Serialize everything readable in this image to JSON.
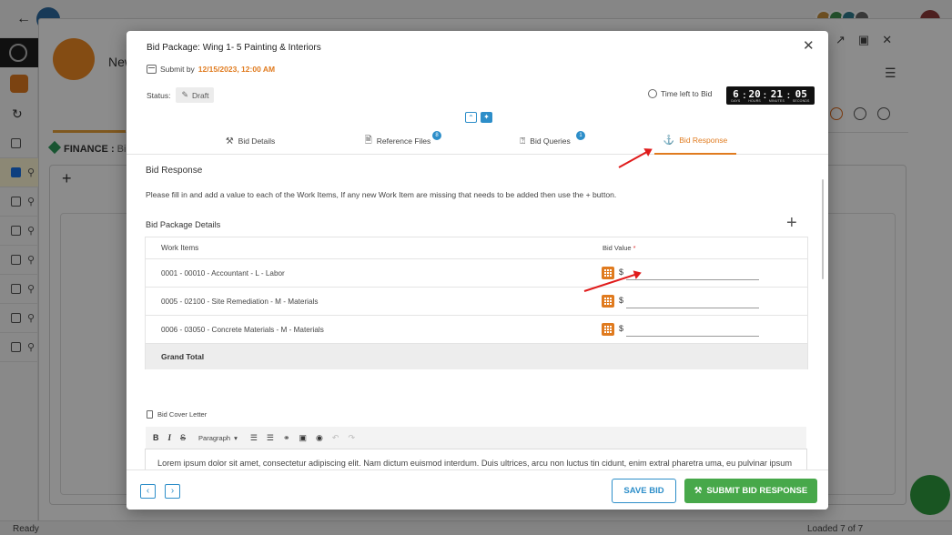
{
  "background": {
    "subwindow_title": "New",
    "finance_label": "FINANCE :",
    "finance_sub": "Bid",
    "status_left": "Ready",
    "status_right": "Loaded 7 of 7"
  },
  "modal": {
    "title": "Bid Package: Wing 1- 5 Painting & Interiors",
    "submit_by_label": "Submit by",
    "submit_by_date": "12/15/2023, 12:00 AM",
    "status_label": "Status:",
    "status_value": "Draft",
    "time_left_label": "Time left to Bid",
    "timer": {
      "days": "6",
      "hours": "20",
      "minutes": "21",
      "seconds": "05",
      "days_unit": "DAYS",
      "hours_unit": "HOURS",
      "minutes_unit": "MINUTES",
      "seconds_unit": "SECONDS"
    },
    "tabs": [
      {
        "label": "Bid Details",
        "icon": "gavel-icon",
        "badge": ""
      },
      {
        "label": "Reference Files",
        "icon": "files-icon",
        "badge": "8"
      },
      {
        "label": "Bid Queries",
        "icon": "question-icon",
        "badge": "1"
      },
      {
        "label": "Bid Response",
        "icon": "bid-response-icon",
        "badge": ""
      }
    ],
    "active_tab": "Bid Response",
    "section_title": "Bid Response",
    "instructions": "Please fill in and add a value to each of the Work Items, If any new Work Item are missing that needs to be added then use the + button.",
    "package_details_title": "Bid Package Details",
    "table": {
      "col_work_items": "Work Items",
      "col_bid_value": "Bid Value",
      "required_mark": "*",
      "currency": "$",
      "rows": [
        {
          "item": "0001 - 00010 - Accountant - L - Labor",
          "value": ""
        },
        {
          "item": "0005 - 02100 - Site Remediation - M - Materials",
          "value": ""
        },
        {
          "item": "0006 - 03050 - Concrete Materials - M - Materials",
          "value": ""
        }
      ],
      "grand_total_label": "Grand Total"
    },
    "cover_letter_label": "Bid Cover Letter",
    "editor": {
      "paragraph_option": "Paragraph",
      "body": "Lorem ipsum dolor sit amet, consectetur adipiscing elit. Nam dictum euismod interdum. Duis ultrices, arcu non luctus tin cidunt, enim extral pharetra uma, eu pulvinar ipsum ante eu nisl. Vivamus gravida turpis eu interdum blandit."
    },
    "footer": {
      "save_label": "SAVE BID",
      "submit_label": "SUBMIT BID RESPONSE"
    }
  },
  "colors": {
    "accent_orange": "#e07b1f",
    "accent_blue": "#2d8ec9",
    "submit_green": "#47a84a",
    "annotation_red": "#e01b1b"
  }
}
